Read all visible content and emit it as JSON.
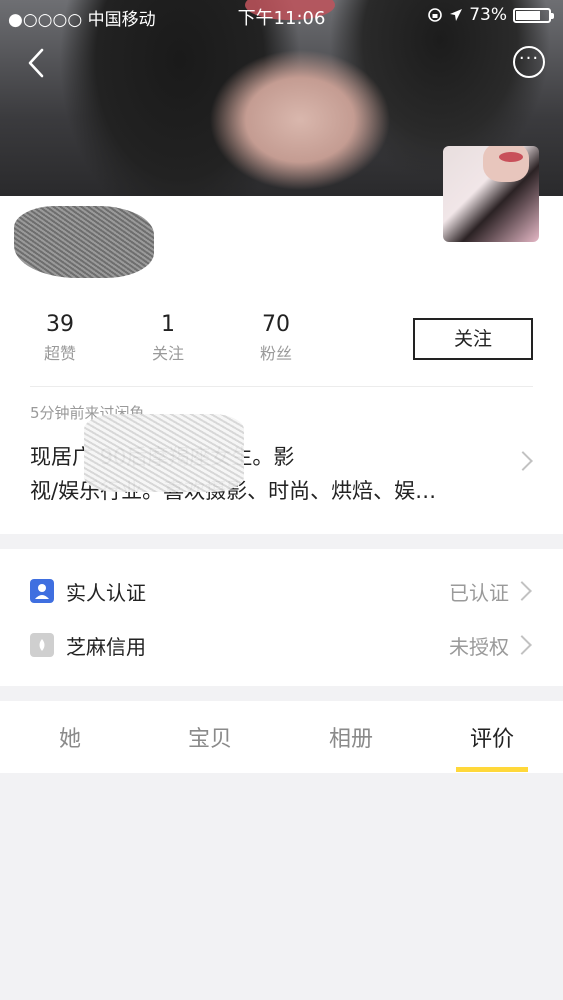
{
  "status_bar": {
    "carrier": "●○○○○ 中国移动",
    "time": "下午11:06",
    "battery": "73%",
    "battery_level": 0.73
  },
  "header": {
    "back_icon": "chevron-left-icon",
    "more_icon": "more-horizontal-icon"
  },
  "profile": {
    "stats": [
      {
        "value": "39",
        "label": "超赞"
      },
      {
        "value": "1",
        "label": "关注"
      },
      {
        "value": "70",
        "label": "粉丝"
      }
    ],
    "follow_label": "关注",
    "last_visit": "5分钟前来过闲鱼",
    "bio_line1": "现居广       90后摩羯座女生。影",
    "bio_line2": "视/娱乐行业。喜欢摄影、时尚、烘焙、娱…"
  },
  "verification": {
    "items": [
      {
        "label": "实人认证",
        "value": "已认证",
        "icon": "id-verify-icon"
      },
      {
        "label": "芝麻信用",
        "value": "未授权",
        "icon": "sesame-credit-icon"
      }
    ]
  },
  "tabs": [
    {
      "label": "她",
      "active": false
    },
    {
      "label": "宝贝",
      "active": false
    },
    {
      "label": "相册",
      "active": false
    },
    {
      "label": "评价",
      "active": true
    }
  ],
  "colors": {
    "accent": "#ffd83a",
    "verify_icon": "#3f6fe0",
    "sesame_icon": "#cfcfcf"
  }
}
